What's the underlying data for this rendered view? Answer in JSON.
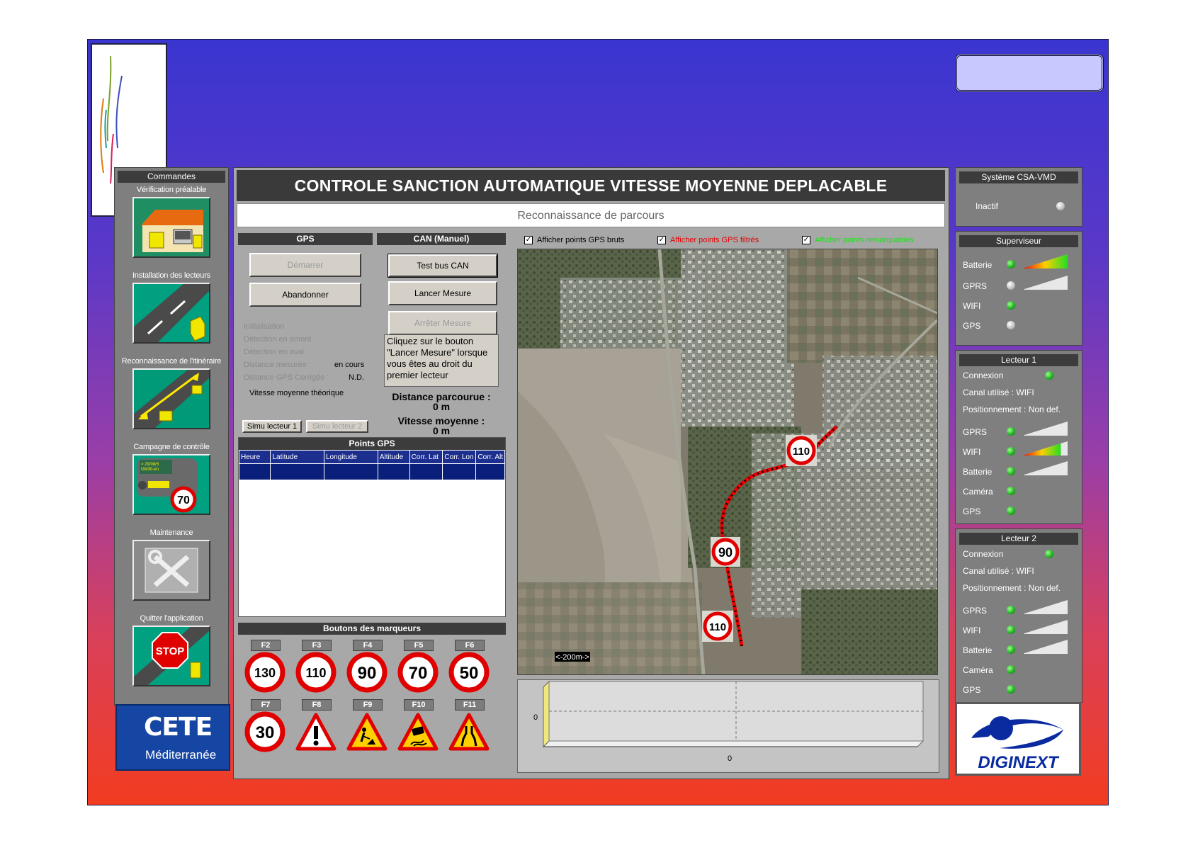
{
  "app": {
    "title": "CONTROLE SANCTION AUTOMATIQUE VITESSE MOYENNE DEPLACABLE",
    "subtitle": "Reconnaissance de parcours"
  },
  "left_panel": {
    "header": "Commandes",
    "items": [
      {
        "label": "Vérification préalable",
        "icon": "house-check-icon"
      },
      {
        "label": "Installation des lecteurs",
        "icon": "road-install-icon"
      },
      {
        "label": "Reconnaissance de l'itinéraire",
        "icon": "route-recon-icon"
      },
      {
        "label": "Campagne de contrôle",
        "icon": "car-speed-70-icon"
      },
      {
        "label": "Maintenance",
        "icon": "tools-icon"
      },
      {
        "label": "Quitter l'application",
        "icon": "stop-sign-icon"
      }
    ]
  },
  "cete_logo": {
    "line1": "CETE",
    "line2": "Méditerranée"
  },
  "gps": {
    "header": "GPS",
    "start_label": "Démarrer",
    "abort_label": "Abandonner",
    "status": {
      "init": "Initialisation",
      "upstream": "Détection en amont",
      "downstream": "Détection en aval",
      "measured_label": "Distance mesurée :",
      "measured_value": "en cours",
      "corrected_label": "Distance GPS Corrigée :",
      "corrected_value": "N.D.",
      "theoretical": "Vitesse moyenne théorique"
    },
    "simu1_label": "Simu lecteur 1",
    "simu2_label": "Simu lecteur 2"
  },
  "can": {
    "header": "CAN (Manuel)",
    "test_label": "Test bus CAN",
    "launch_label": "Lancer Mesure",
    "stop_label": "Arrêter Mesure",
    "info_text": "Cliquez sur le bouton \"Lancer Mesure\" lorsque vous êtes au droit du premier lecteur",
    "distance_label": "Distance parcourue :",
    "distance_value": "0 m",
    "speed_label": "Vitesse moyenne :",
    "speed_value": "0 m"
  },
  "gps_points": {
    "header": "Points GPS",
    "columns": [
      "Heure",
      "Latitude",
      "Longitude",
      "Altitude",
      "Corr. Lat",
      "Corr. Lon",
      "Corr. Alt"
    ]
  },
  "markers": {
    "header": "Boutons des marqueurs",
    "row1": [
      {
        "key": "F2",
        "sign": "130"
      },
      {
        "key": "F3",
        "sign": "110"
      },
      {
        "key": "F4",
        "sign": "90"
      },
      {
        "key": "F5",
        "sign": "70"
      },
      {
        "key": "F6",
        "sign": "50"
      }
    ],
    "row2": [
      {
        "key": "F7",
        "sign": "30"
      },
      {
        "key": "F8",
        "sign": "danger-icon"
      },
      {
        "key": "F9",
        "sign": "roadworks-icon"
      },
      {
        "key": "F10",
        "sign": "slippery-road-icon"
      },
      {
        "key": "F11",
        "sign": "road-narrows-icon"
      }
    ]
  },
  "map": {
    "check_raw": "Afficher points GPS bruts",
    "check_filtered": "Afficher points GPS filtrés",
    "check_remarkable": "Afficher points remarquables",
    "colors": {
      "raw": "#000000",
      "filtered": "#e80000",
      "remarkable": "#22dd22"
    },
    "scale": "<-200m->",
    "signs": [
      "110",
      "90",
      "110"
    ]
  },
  "graph": {
    "y_tick": "0",
    "x_tick": "0"
  },
  "right_panel": {
    "system": {
      "header": "Système CSA-VMD",
      "status": "Inactif"
    },
    "supervisor": {
      "header": "Superviseur",
      "rows": [
        {
          "label": "Batterie",
          "led": "green",
          "signal": 1.0
        },
        {
          "label": "GPRS",
          "led": "grey",
          "signal": 0
        },
        {
          "label": "WIFI",
          "led": "green"
        },
        {
          "label": "GPS",
          "led": "grey"
        }
      ]
    },
    "reader1": {
      "header": "Lecteur 1",
      "connection": "Connexion",
      "channel": "Canal utilisé : WIFI",
      "position": "Positionnement : Non def.",
      "rows": [
        {
          "label": "GPRS",
          "led": "green",
          "signal": 0
        },
        {
          "label": "WIFI",
          "led": "green",
          "signal": 0.85
        },
        {
          "label": "Batterie",
          "led": "green",
          "signal": 0
        },
        {
          "label": "Caméra",
          "led": "green"
        },
        {
          "label": "GPS",
          "led": "green"
        }
      ]
    },
    "reader2": {
      "header": "Lecteur 2",
      "connection": "Connexion",
      "channel": "Canal utilisé : WIFI",
      "position": "Positionnement : Non def.",
      "rows": [
        {
          "label": "GPRS",
          "led": "green",
          "signal": 0
        },
        {
          "label": "WIFI",
          "led": "green",
          "signal": 0
        },
        {
          "label": "Batterie",
          "led": "green",
          "signal": 0
        },
        {
          "label": "Caméra",
          "led": "green"
        },
        {
          "label": "GPS",
          "led": "green"
        }
      ]
    }
  },
  "diginext": {
    "name": "DIGINEXT"
  }
}
